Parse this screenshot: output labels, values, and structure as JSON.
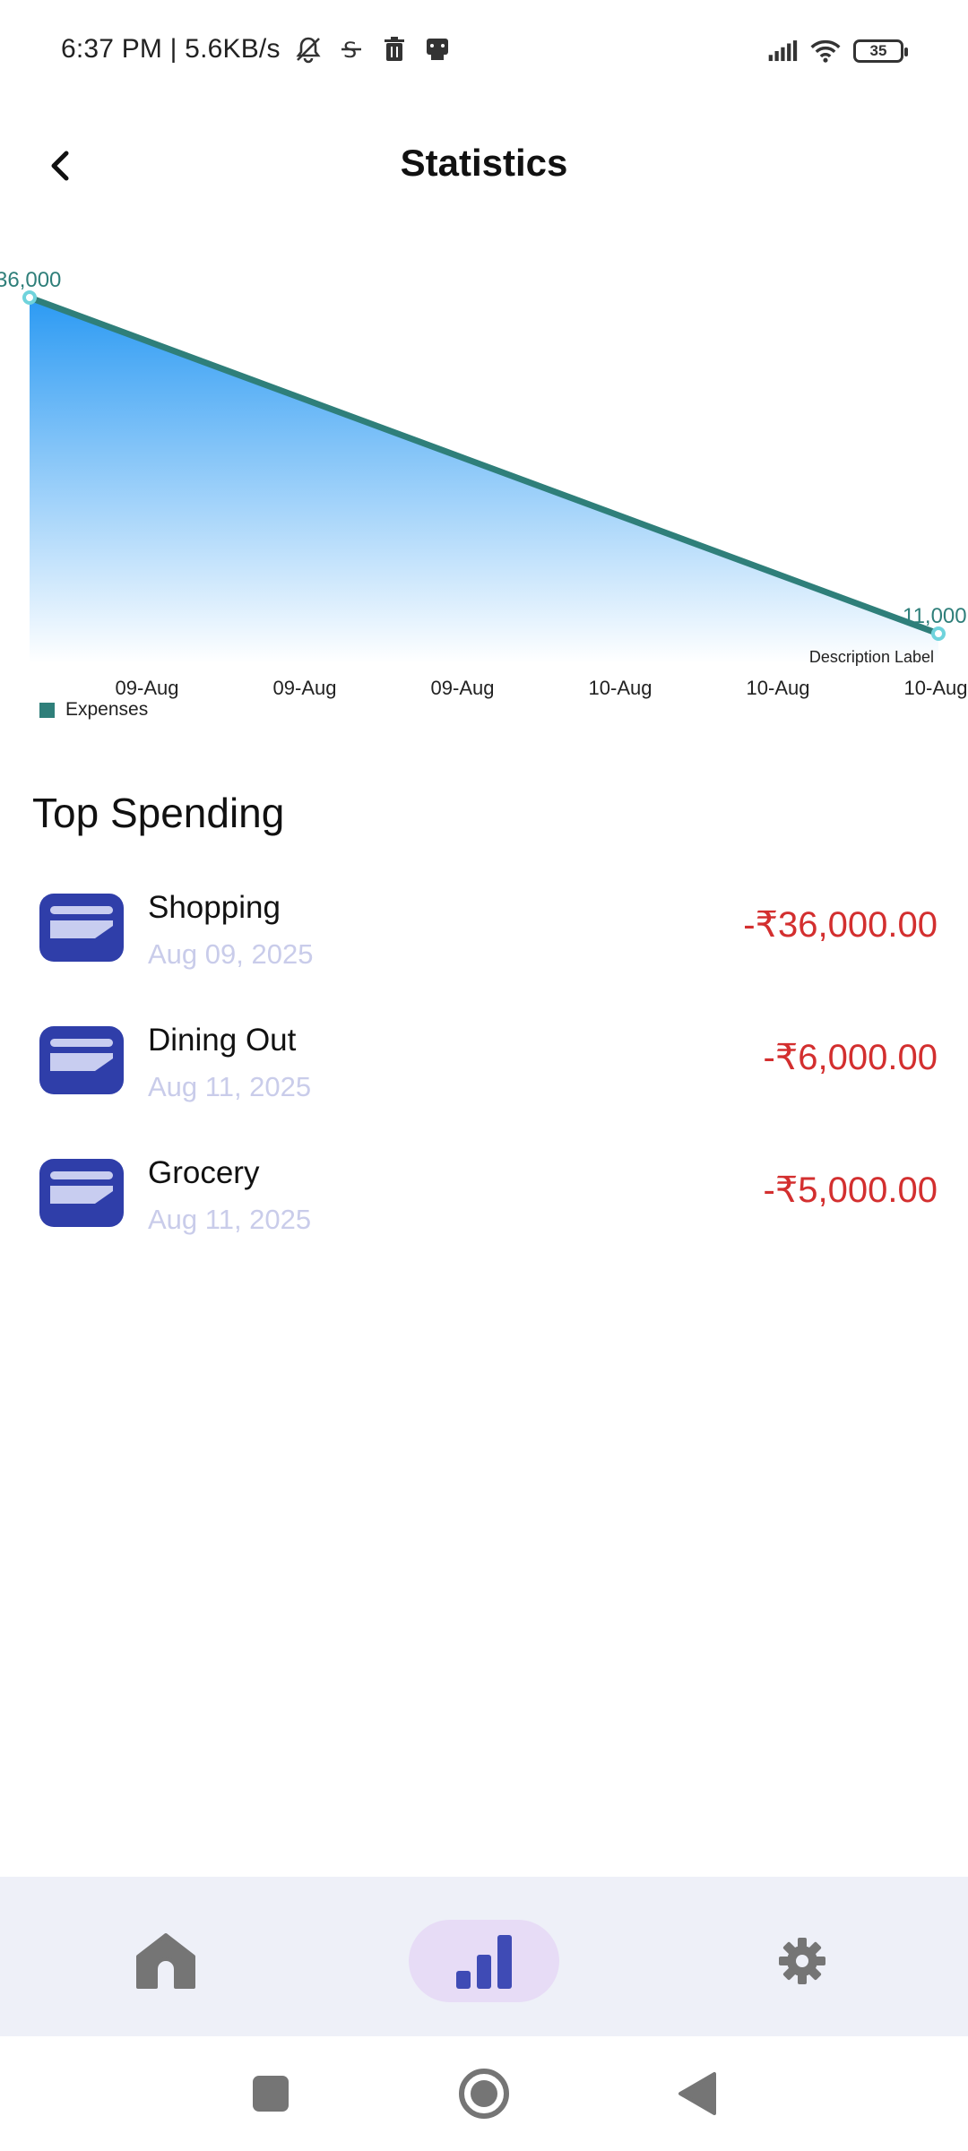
{
  "status_bar": {
    "time_speed": "6:37 PM | 5.6KB/s",
    "battery_level": "35",
    "icons": [
      "muted-bell-icon",
      "sim-icon",
      "trash-icon",
      "notification-icon",
      "signal-icon",
      "wifi-icon",
      "battery-icon"
    ]
  },
  "header": {
    "title": "Statistics",
    "back_icon": "chevron-left-icon"
  },
  "chart_data": {
    "type": "area",
    "x": [
      "09-Aug",
      "09-Aug",
      "09-Aug",
      "10-Aug",
      "10-Aug",
      "10-Aug"
    ],
    "series": [
      {
        "name": "Expenses",
        "points": [
          [
            0,
            36000
          ],
          [
            1,
            11000
          ]
        ],
        "point_labels": [
          "36,000",
          "11,000"
        ],
        "line_color": "#2f7f7a",
        "fill_top": "#2b9af3",
        "fill_bottom": "#ffffff"
      }
    ],
    "description_label": "Description Label",
    "legend": "bottom-left",
    "grid": false
  },
  "top_spending": {
    "title": "Top Spending",
    "items": [
      {
        "name": "Shopping",
        "date": "Aug 09, 2025",
        "amount": "-₹36,000.00"
      },
      {
        "name": "Dining Out",
        "date": "Aug 11, 2025",
        "amount": "-₹6,000.00"
      },
      {
        "name": "Grocery",
        "date": "Aug 11, 2025",
        "amount": "-₹5,000.00"
      }
    ],
    "amount_color": "#d32f2f",
    "icon_color": "#2f3ea9"
  },
  "bottom_nav": {
    "items": [
      {
        "icon": "home-icon",
        "active": false
      },
      {
        "icon": "bar-chart-icon",
        "active": true
      },
      {
        "icon": "gear-icon",
        "active": false
      }
    ],
    "active_color": "#3f4bb5"
  },
  "system_nav": {
    "icons": [
      "recent-apps-icon",
      "home-circle-icon",
      "back-triangle-icon"
    ]
  }
}
